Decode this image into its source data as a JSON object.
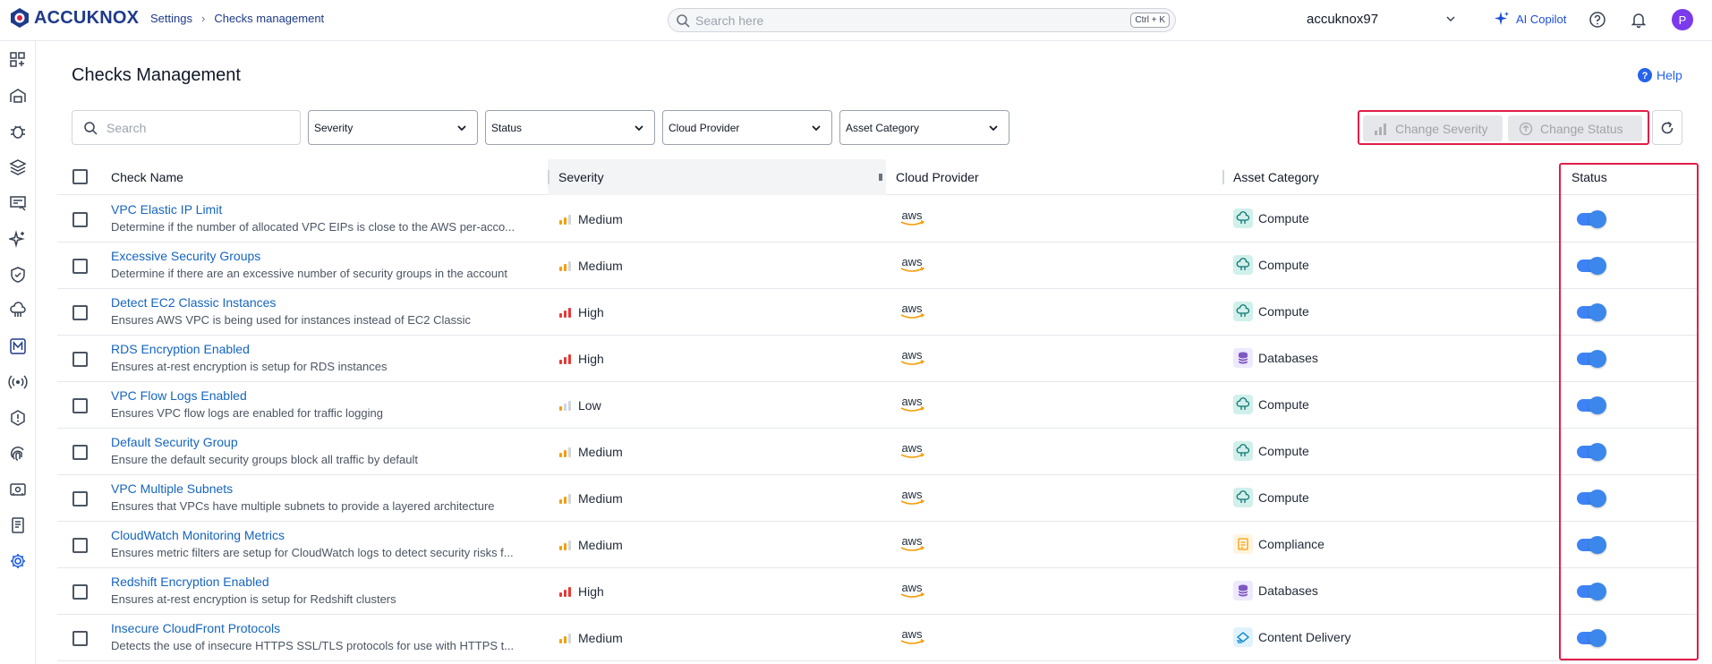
{
  "header": {
    "logo_text": "ACCUKNOX",
    "breadcrumb": [
      "Settings",
      "Checks management"
    ],
    "search_placeholder": "Search here",
    "search_shortcut": "Ctrl + K",
    "tenant": "accuknox97",
    "copilot_label": "AI Copilot",
    "avatar_initial": "P"
  },
  "sidebar": {
    "icons": [
      "dashboard-icon",
      "inventory-icon",
      "vulnerability-bug-icon",
      "layers-icon",
      "issues-icon",
      "ai-sparkle-icon",
      "shield-icon",
      "cloud-workload-icon",
      "m-badge-icon",
      "network-signal-icon",
      "settings-warning-icon",
      "fingerprint-icon",
      "ticket-icon",
      "reports-icon",
      "settings-gear-icon"
    ],
    "active": "settings-gear-icon"
  },
  "page": {
    "title": "Checks Management",
    "help_label": "Help"
  },
  "filters": {
    "search_placeholder": "Search",
    "severity": "Severity",
    "status": "Status",
    "cloud_provider": "Cloud Provider",
    "asset_category": "Asset Category"
  },
  "actions": {
    "change_severity": "Change Severity",
    "change_status": "Change Status"
  },
  "table": {
    "columns": [
      "Check Name",
      "Severity",
      "Cloud Provider",
      "Asset Category",
      "Status"
    ],
    "rows": [
      {
        "name": "VPC Elastic IP Limit",
        "desc": "Determine if the number of allocated VPC EIPs is close to the AWS per-acco...",
        "severity": "Medium",
        "provider": "aws",
        "asset": "Compute",
        "enabled": true
      },
      {
        "name": "Excessive Security Groups",
        "desc": "Determine if there are an excessive number of security groups in the account",
        "severity": "Medium",
        "provider": "aws",
        "asset": "Compute",
        "enabled": true
      },
      {
        "name": "Detect EC2 Classic Instances",
        "desc": "Ensures AWS VPC is being used for instances instead of EC2 Classic",
        "severity": "High",
        "provider": "aws",
        "asset": "Compute",
        "enabled": true
      },
      {
        "name": "RDS Encryption Enabled",
        "desc": "Ensures at-rest encryption is setup for RDS instances",
        "severity": "High",
        "provider": "aws",
        "asset": "Databases",
        "enabled": true
      },
      {
        "name": "VPC Flow Logs Enabled",
        "desc": "Ensures VPC flow logs are enabled for traffic logging",
        "severity": "Low",
        "provider": "aws",
        "asset": "Compute",
        "enabled": true
      },
      {
        "name": "Default Security Group",
        "desc": "Ensure the default security groups block all traffic by default",
        "severity": "Medium",
        "provider": "aws",
        "asset": "Compute",
        "enabled": true
      },
      {
        "name": "VPC Multiple Subnets",
        "desc": "Ensures that VPCs have multiple subnets to provide a layered architecture",
        "severity": "Medium",
        "provider": "aws",
        "asset": "Compute",
        "enabled": true
      },
      {
        "name": "CloudWatch Monitoring Metrics",
        "desc": "Ensures metric filters are setup for CloudWatch logs to detect security risks f...",
        "severity": "Medium",
        "provider": "aws",
        "asset": "Compliance",
        "enabled": true
      },
      {
        "name": "Redshift Encryption Enabled",
        "desc": "Ensures at-rest encryption is setup for Redshift clusters",
        "severity": "High",
        "provider": "aws",
        "asset": "Databases",
        "enabled": true
      },
      {
        "name": "Insecure CloudFront Protocols",
        "desc": "Detects the use of insecure HTTPS SSL/TLS protocols for use with HTTPS t...",
        "severity": "Medium",
        "provider": "aws",
        "asset": "Content Delivery",
        "enabled": true
      }
    ]
  },
  "colors": {
    "link": "#1565c0",
    "highlight_border": "#e11d48",
    "toggle_on": "#1a73e8",
    "severity_high": "#e53935",
    "severity_medium": "#f59e0b",
    "severity_low": "#f59e0b"
  }
}
